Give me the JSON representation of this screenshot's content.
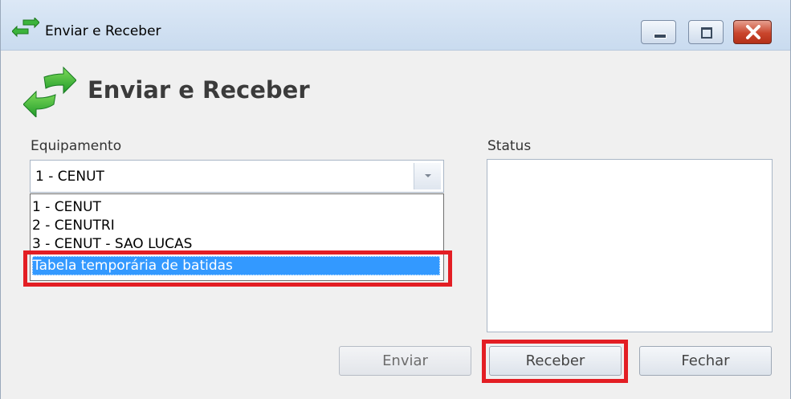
{
  "window": {
    "title": "Enviar e Receber",
    "controls": {
      "minimize": "minimize-icon",
      "maximize": "maximize-icon",
      "close": "close-icon"
    }
  },
  "header": {
    "title": "Enviar e Receber",
    "icon": "send-receive-arrows-icon"
  },
  "equipamento": {
    "label": "Equipamento",
    "selected": "1 - CENUT",
    "options": [
      "1 - CENUT",
      "2 - CENUTRI",
      "3 - CENUT - SAO LUCAS",
      "Tabela temporária de batidas"
    ],
    "highlighted_option": "Tabela temporária de batidas"
  },
  "status": {
    "label": "Status",
    "value": ""
  },
  "buttons": {
    "enviar": "Enviar",
    "receber": "Receber",
    "fechar": "Fechar"
  },
  "colors": {
    "annotation_red": "#e31e24",
    "selection_blue": "#3399ff",
    "arrow_green": "#2fa82f"
  }
}
